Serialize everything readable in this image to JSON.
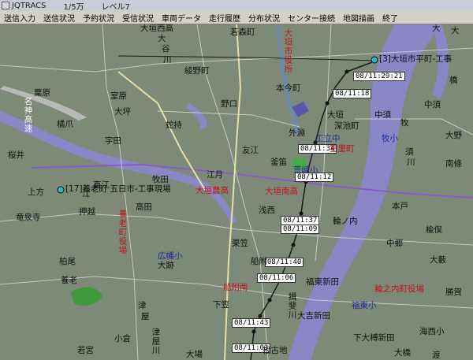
{
  "window": {
    "title": "JQTRACS",
    "scale": "1/5万",
    "level": "レベル7"
  },
  "menu": [
    "送信入力",
    "送信状況",
    "予約状況",
    "受信状況",
    "車両データ",
    "走行履歴",
    "分布状況",
    "センター接続",
    "地図描画",
    "終了"
  ],
  "vehicles": [
    {
      "label": "[3]大垣市平町-工事"
    },
    {
      "label": "[17]養老町 五日市-工事現場"
    }
  ],
  "timestamps": [
    "08/11:29:21",
    "08/11:18",
    "08/11:34",
    "08/11:12",
    "08/11:37",
    "08/11:09",
    "08/11:40",
    "08/11:06",
    "08/11:43",
    "08/11:03"
  ],
  "place_labels": [
    {
      "t": "大垣西高",
      "c": ""
    },
    {
      "t": "大",
      "c": ""
    },
    {
      "t": "谷",
      "c": ""
    },
    {
      "t": "川",
      "c": ""
    },
    {
      "t": "若森町",
      "c": ""
    },
    {
      "t": "大垣市役所",
      "c": "red"
    },
    {
      "t": "綾野町",
      "c": ""
    },
    {
      "t": "本今町",
      "c": ""
    },
    {
      "t": "粟原",
      "c": ""
    },
    {
      "t": "室原",
      "c": ""
    },
    {
      "t": "野口",
      "c": ""
    },
    {
      "t": "大坪",
      "c": ""
    },
    {
      "t": "中須",
      "c": ""
    },
    {
      "t": "中須",
      "c": ""
    },
    {
      "t": "橘爪",
      "c": ""
    },
    {
      "t": "蛇持",
      "c": ""
    },
    {
      "t": "外淵",
      "c": ""
    },
    {
      "t": "深池町",
      "c": ""
    },
    {
      "t": "牧",
      "c": ""
    },
    {
      "t": "宇田",
      "c": ""
    },
    {
      "t": "桜井",
      "c": ""
    },
    {
      "t": "友江",
      "c": ""
    },
    {
      "t": "釜笛",
      "c": ""
    },
    {
      "t": "荒崎小",
      "c": ""
    },
    {
      "t": "室里町",
      "c": "red"
    },
    {
      "t": "大野",
      "c": ""
    },
    {
      "t": "南條",
      "c": ""
    },
    {
      "t": "上方",
      "c": ""
    },
    {
      "t": "直江",
      "c": ""
    },
    {
      "t": "牧田",
      "c": ""
    },
    {
      "t": "江月",
      "c": ""
    },
    {
      "t": "大垣農高",
      "c": "red"
    },
    {
      "t": "大垣南高",
      "c": "red"
    },
    {
      "t": "竜泉寺",
      "c": ""
    },
    {
      "t": "押越",
      "c": ""
    },
    {
      "t": "高田",
      "c": ""
    },
    {
      "t": "浅西",
      "c": ""
    },
    {
      "t": "本戸",
      "c": ""
    },
    {
      "t": "輪ノ内",
      "c": ""
    },
    {
      "t": "楡俣",
      "c": ""
    },
    {
      "t": "中郷",
      "c": ""
    },
    {
      "t": "大藪",
      "c": ""
    },
    {
      "t": "栗笠",
      "c": ""
    },
    {
      "t": "柏尾",
      "c": ""
    },
    {
      "t": "広幡小",
      "c": "blue"
    },
    {
      "t": "大跡",
      "c": ""
    },
    {
      "t": "船附",
      "c": ""
    },
    {
      "t": "養老",
      "c": ""
    },
    {
      "t": "福東新田",
      "c": ""
    },
    {
      "t": "輪之内町役場",
      "c": "red"
    },
    {
      "t": "勝賀",
      "c": ""
    },
    {
      "t": "船附南",
      "c": "red"
    },
    {
      "t": "下笠",
      "c": ""
    },
    {
      "t": "大吉新田",
      "c": ""
    },
    {
      "t": "下大榑新田",
      "c": ""
    },
    {
      "t": "海西小",
      "c": ""
    },
    {
      "t": "若宮",
      "c": ""
    },
    {
      "t": "小倉",
      "c": ""
    },
    {
      "t": "津",
      "c": ""
    },
    {
      "t": "屋",
      "c": ""
    },
    {
      "t": "大場",
      "c": ""
    },
    {
      "t": "根古地",
      "c": ""
    },
    {
      "t": "大橋",
      "c": ""
    },
    {
      "t": "福東小",
      "c": "blue"
    },
    {
      "t": "揖斐川",
      "c": ""
    },
    {
      "t": "江",
      "c": ""
    },
    {
      "t": "橋",
      "c": ""
    },
    {
      "t": "大",
      "c": ""
    },
    {
      "t": "名神高速",
      "c": "hwy"
    },
    {
      "t": "養老町役場",
      "c": "red"
    },
    {
      "t": "須",
      "c": ""
    },
    {
      "t": "川",
      "c": ""
    },
    {
      "t": "牧小",
      "c": "blue"
    },
    {
      "t": "津屋川",
      "c": ""
    },
    {
      "t": "工立中",
      "c": "blue"
    },
    {
      "t": "渡",
      "c": ""
    },
    {
      "t": "大垣",
      "c": ""
    },
    {
      "t": "大",
      "c": ""
    }
  ],
  "colors": {
    "map_bg": "#7d8a77",
    "river": "#8a83c4",
    "route": "#1a1a1a",
    "timestamp_bg": "#ffffff",
    "red_label": "#c0141c"
  }
}
